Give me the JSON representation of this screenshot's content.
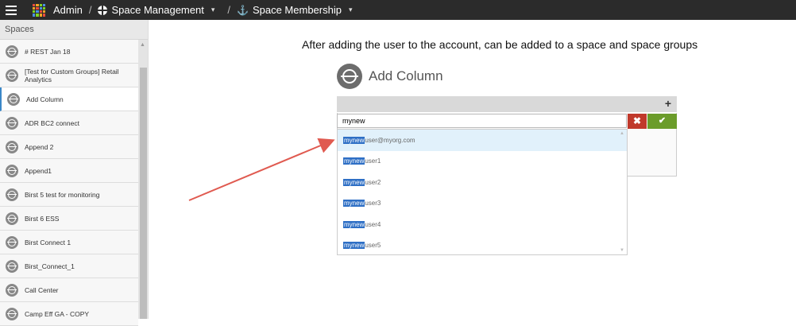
{
  "topbar": {
    "admin": "Admin",
    "separator": "/",
    "space_management": "Space Management",
    "space_membership": "Space Membership"
  },
  "sidebar": {
    "header": "Spaces",
    "items": [
      "# REST Jan 18",
      "[Test for Custom Groups] Retail Analytics",
      "Add Column",
      "ADR BC2 connect",
      "Append 2",
      "Append1",
      "Birst 5 test for monitoring",
      "Birst 6 ESS",
      "Birst Connect 1",
      "Birst_Connect_1",
      "Call Center",
      "Camp Eff GA - COPY"
    ],
    "active_index": 2
  },
  "main": {
    "instruction": "After adding the user to the account, can be added to a space and space groups",
    "title": "Add Column",
    "search_value": "mynew",
    "suggestions": [
      {
        "match": "mynew",
        "rest": "user@myorg.com"
      },
      {
        "match": "mynew",
        "rest": "user1"
      },
      {
        "match": "mynew",
        "rest": "user2"
      },
      {
        "match": "mynew",
        "rest": "user3"
      },
      {
        "match": "mynew",
        "rest": "user4"
      },
      {
        "match": "mynew",
        "rest": "user5"
      }
    ],
    "plus_label": "+",
    "cancel_label": "✖",
    "ok_label": "✔"
  },
  "colors": {
    "topbar": "#2b2b2b",
    "accent": "#3a87c8",
    "cancel": "#c0392b",
    "ok": "#6b9c2a",
    "arrow": "#e05a50"
  }
}
